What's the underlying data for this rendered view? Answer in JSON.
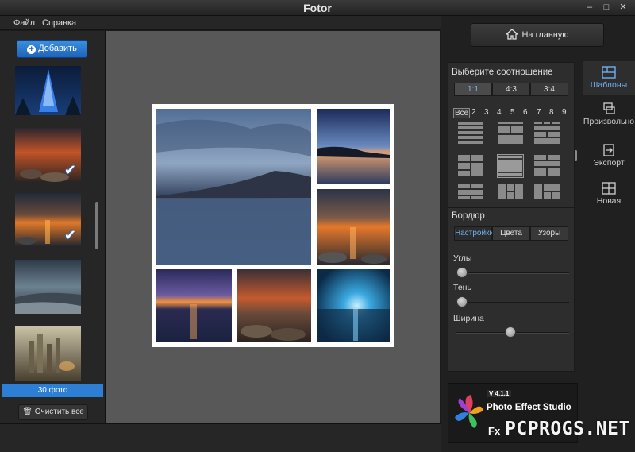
{
  "window": {
    "title": "Fotor"
  },
  "menu": {
    "file": "Файл",
    "help": "Справка"
  },
  "left_panel": {
    "add_label": "Добавить",
    "photo_count": "30 фото",
    "clear_label": "Очистить все",
    "thumbnails": [
      {
        "name": "christmas-tree",
        "checked": false
      },
      {
        "name": "sunset-rocks",
        "checked": true
      },
      {
        "name": "sunset-beach",
        "checked": true
      },
      {
        "name": "stormy-coast",
        "checked": false
      },
      {
        "name": "fantasy-city",
        "checked": false
      }
    ]
  },
  "right_panel": {
    "home_label": "На главную",
    "ratio_title": "Выберите соотношение",
    "ratios": [
      "1:1",
      "4:3",
      "3:4"
    ],
    "active_ratio": "1:1",
    "counts": [
      "Все",
      "2",
      "3",
      "4",
      "5",
      "6",
      "7",
      "8",
      "9"
    ],
    "active_count": "Все",
    "border_title": "Бордюр",
    "border_tabs": [
      "Настройки",
      "Цвета",
      "Узоры"
    ],
    "active_border_tab": "Настройки",
    "sliders": [
      {
        "label": "Углы",
        "value": 0
      },
      {
        "label": "Тень",
        "value": 0
      },
      {
        "label": "Ширина",
        "value": 0.48
      }
    ],
    "tools": [
      {
        "label": "Шаблоны",
        "icon": "templates-icon",
        "active": true
      },
      {
        "label": "Произвольно",
        "icon": "freestyle-icon",
        "active": false
      },
      {
        "label": "Экспорт",
        "icon": "export-icon",
        "active": false
      },
      {
        "label": "Новая",
        "icon": "new-icon",
        "active": false
      }
    ],
    "promo": {
      "version": "V 4.1.1",
      "name": "Photo Effect Studio",
      "fx": "Fx"
    }
  },
  "watermark": "PCPROGS.NET",
  "colors": {
    "accent": "#2d7fd6",
    "active_text": "#6fb0f0"
  }
}
